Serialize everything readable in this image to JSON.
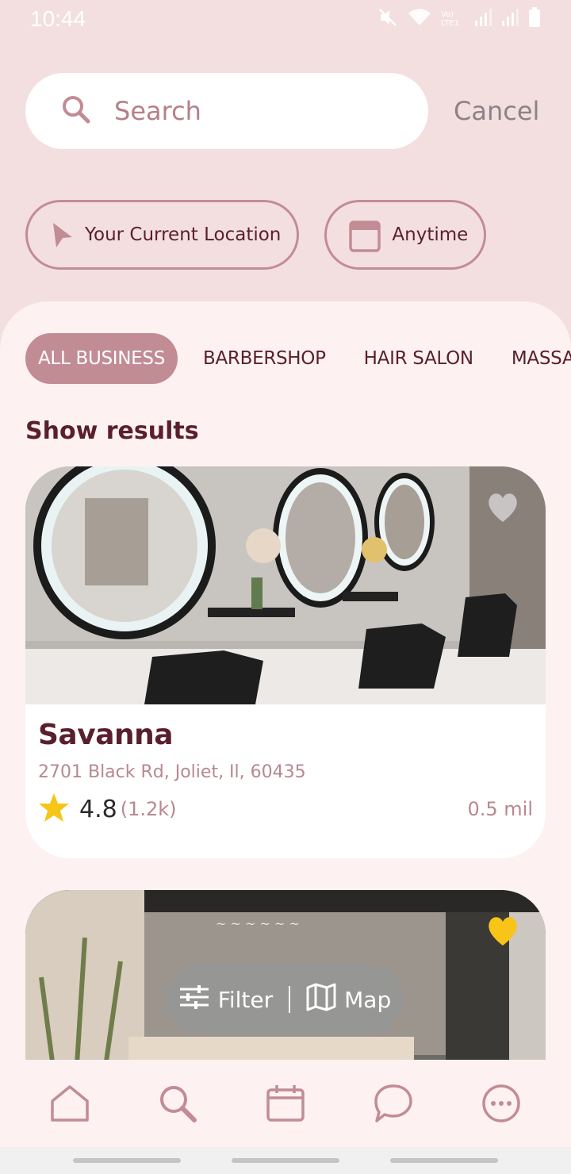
{
  "status_bar": {
    "time": "10:44",
    "network": "Vo) LTE1"
  },
  "search": {
    "placeholder": "Search",
    "cancel_label": "Cancel"
  },
  "chips": [
    {
      "label": "Your Current Location",
      "icon": "location-arrow-icon"
    },
    {
      "label": "Anytime",
      "icon": "calendar-icon"
    }
  ],
  "tabs": [
    {
      "label": "ALL BUSINESS",
      "active": true
    },
    {
      "label": "BARBERSHOP",
      "active": false
    },
    {
      "label": "HAIR SALON",
      "active": false
    },
    {
      "label": "MASSA",
      "active": false
    }
  ],
  "section_title": "Show results",
  "results": [
    {
      "name": "Savanna",
      "address": "2701 Black Rd, Joliet, Il, 60435",
      "rating": "4.8",
      "reviews": "(1.2k)",
      "distance": "0.5 mil",
      "favorite": false
    },
    {
      "name": "",
      "favorite": true
    }
  ],
  "fab": {
    "filter_label": "Filter",
    "map_label": "Map"
  },
  "bottom_nav": [
    "home-icon",
    "search-icon",
    "calendar-icon",
    "chat-icon",
    "more-icon"
  ],
  "colors": {
    "accent": "#c28c94",
    "text": "#5a1f2c",
    "background": "#f3dfe0",
    "sheet": "#fdf1f1",
    "favorite_active": "#f7c417"
  }
}
